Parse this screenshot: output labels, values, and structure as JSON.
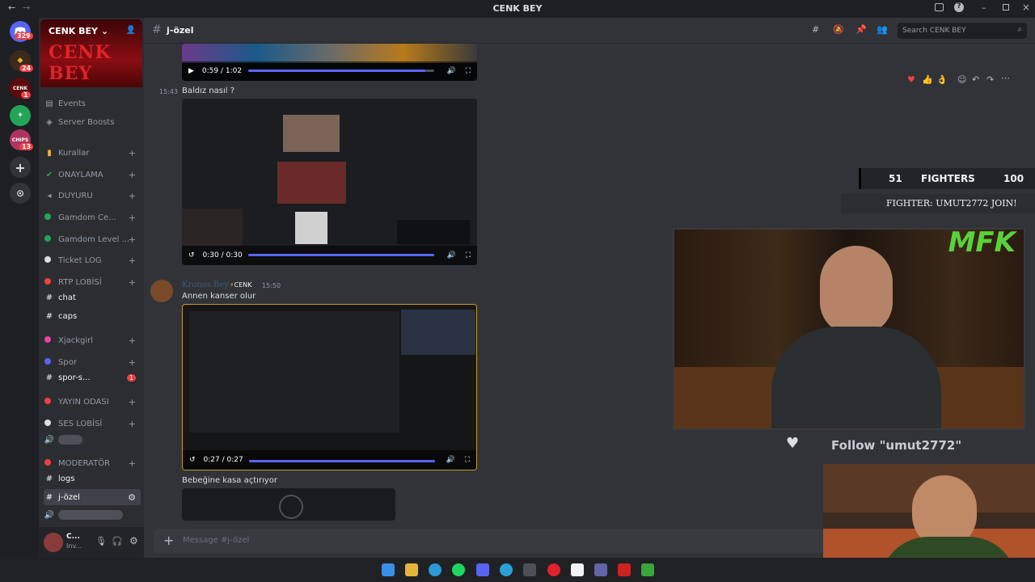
{
  "window": {
    "title": "CENK BEY"
  },
  "rail": {
    "badges": [
      "329",
      "24",
      "1",
      "13"
    ]
  },
  "server": {
    "name": "CENK BEY",
    "banner_logo": "CENK BEY"
  },
  "sidebar": {
    "top_items": [
      {
        "label": "Events"
      },
      {
        "label": "Server Boosts"
      }
    ],
    "channels": [
      {
        "label": "Kurallar",
        "icon": "rules-icon"
      },
      {
        "label": "ONAYLAMA",
        "icon": "check-icon"
      },
      {
        "label": "DUYURU",
        "icon": "megaphone-icon"
      },
      {
        "label": "Gamdom Ce...",
        "icon": "dot-icon"
      },
      {
        "label": "Gamdom Level ...",
        "icon": "dot-icon"
      },
      {
        "label": "Ticket LOG",
        "icon": "dot-icon"
      },
      {
        "label": "RTP LOBİSİ",
        "icon": "dot-icon"
      },
      {
        "label": "chat",
        "icon": "hash-icon"
      },
      {
        "label": "caps",
        "icon": "hash-icon"
      },
      {
        "label": "Xjackgirl",
        "icon": "dot-icon"
      },
      {
        "label": "Spor",
        "icon": "dot-icon"
      },
      {
        "label": "spor-s...",
        "icon": "hash-icon",
        "badge": "1"
      },
      {
        "label": "YAYIN ODASI",
        "icon": "dot-icon"
      },
      {
        "label": "SES LOBİSİ",
        "icon": "dot-icon"
      },
      {
        "label": "MODERATÖR",
        "icon": "dot-icon"
      },
      {
        "label": "logs",
        "icon": "hash-icon"
      },
      {
        "label": "j-özel",
        "icon": "hash-icon"
      }
    ],
    "user": {
      "name": "C...",
      "status": "Inv..."
    }
  },
  "header": {
    "channel": "j-özel",
    "search_placeholder": "Search CENK BEY"
  },
  "messages": [
    {
      "time": "15:43",
      "text": "Baldız nasıl ?"
    },
    {
      "author": "Kronos Bey",
      "tag": "CENK",
      "time": "15:50",
      "text": "Annen kanser olur"
    },
    {
      "text": "Bebeğine kasa açtırıyor"
    }
  ],
  "videos": [
    {
      "time": "0:59 / 1:02",
      "progress": 0.95
    },
    {
      "time": "0:30 / 0:30",
      "progress": 1.0
    },
    {
      "time": "0:27 / 0:27",
      "progress": 1.0
    }
  ],
  "composer": {
    "placeholder": "Message #j-özel"
  },
  "overlay": {
    "fighters_left": "51",
    "fighters_label": "FIGHTERS",
    "fighters_right": "100",
    "join_text": "FIGHTER: UMUT2772 JOIN!",
    "brand": "MFK",
    "follow_text": "Follow \"umut2772\""
  },
  "colors": {
    "accent": "#5865f2",
    "sidebar": "#2b2d31",
    "chat": "#313338",
    "rail": "#1e1f22",
    "banner": "#8a0d12"
  }
}
